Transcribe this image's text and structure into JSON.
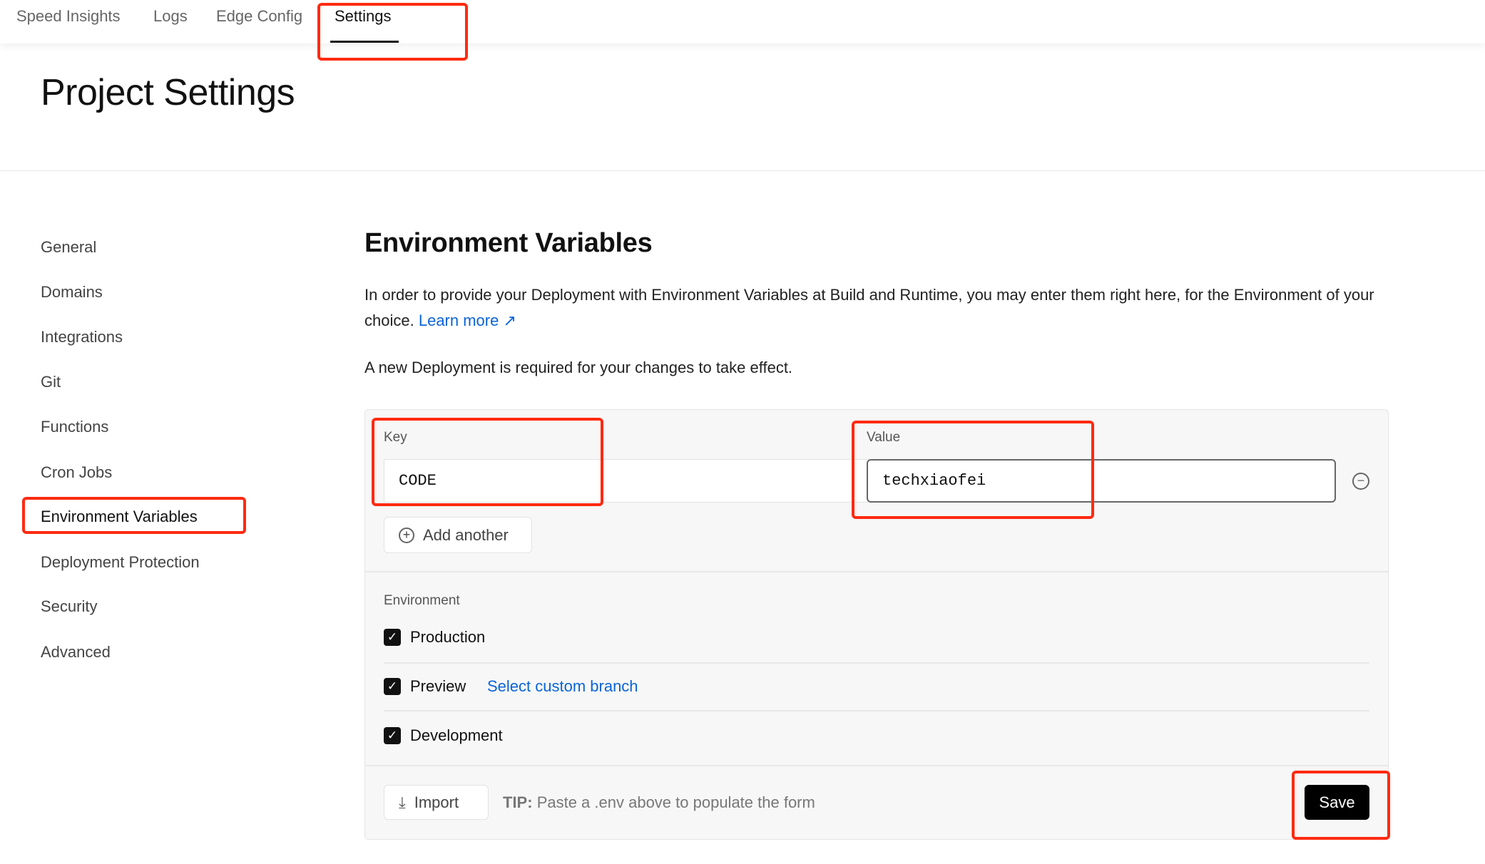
{
  "nav": {
    "tabs": [
      {
        "label": "Speed Insights"
      },
      {
        "label": "Logs"
      },
      {
        "label": "Edge Config"
      },
      {
        "label": "Settings",
        "active": true
      }
    ]
  },
  "page_title": "Project Settings",
  "sidebar": {
    "items": [
      {
        "label": "General"
      },
      {
        "label": "Domains"
      },
      {
        "label": "Integrations"
      },
      {
        "label": "Git"
      },
      {
        "label": "Functions"
      },
      {
        "label": "Cron Jobs"
      },
      {
        "label": "Environment Variables",
        "active": true
      },
      {
        "label": "Deployment Protection"
      },
      {
        "label": "Security"
      },
      {
        "label": "Advanced"
      }
    ]
  },
  "section": {
    "title": "Environment Variables",
    "description": "In order to provide your Deployment with Environment Variables at Build and Runtime, you may enter them right here, for the Environment of your choice.",
    "learn_more": "Learn more",
    "note": "A new Deployment is required for your changes to take effect."
  },
  "form": {
    "key_label": "Key",
    "key_value": "CODE",
    "value_label": "Value",
    "value_value": "techxiaofei",
    "add_another": "Add another",
    "environment_label": "Environment",
    "environments": [
      {
        "label": "Production",
        "checked": true
      },
      {
        "label": "Preview",
        "checked": true
      },
      {
        "label": "Development",
        "checked": true
      }
    ],
    "custom_branch": "Select custom branch",
    "import": "Import",
    "tip_prefix": "TIP:",
    "tip": "Paste a .env above to populate the form",
    "save": "Save"
  },
  "colors": {
    "accent_link": "#0a64d8",
    "highlight": "#ff2a10",
    "primary_button": "#000000"
  }
}
